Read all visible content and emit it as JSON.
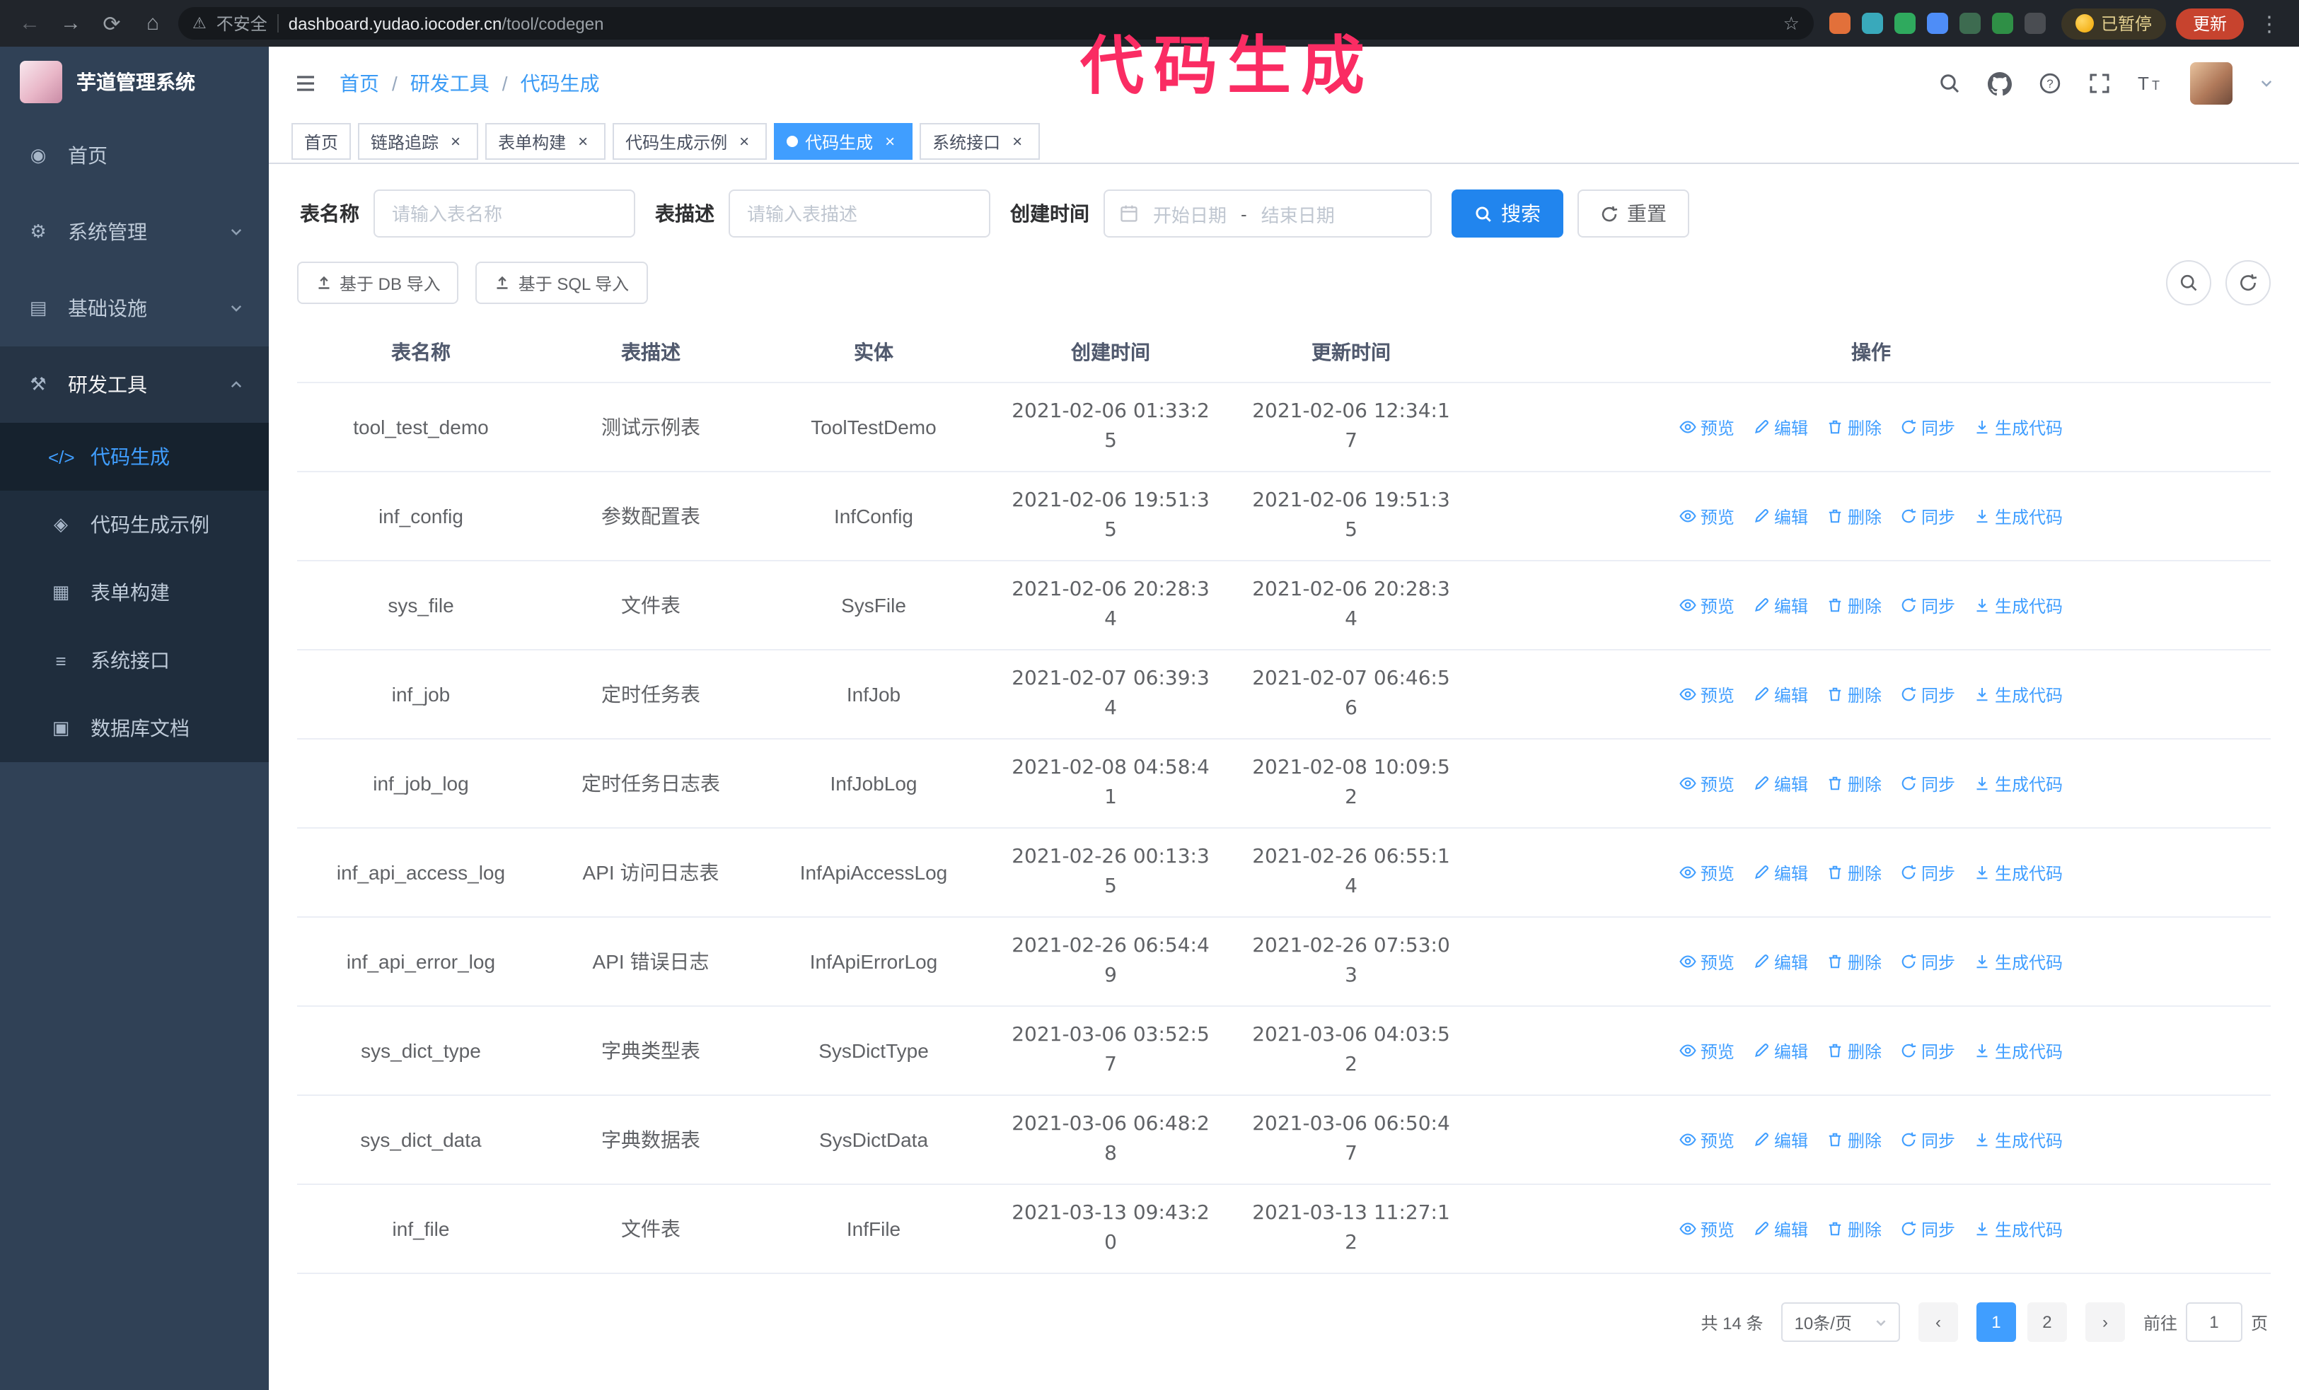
{
  "browser": {
    "security_warning": "不安全",
    "url_host": "dashboard.yudao.iocoder.cn",
    "url_path": "/tool/codegen",
    "extensions": [
      {
        "name": "extension-orange",
        "color": "#e2703a"
      },
      {
        "name": "extension-teal",
        "color": "#39a9bb"
      },
      {
        "name": "extension-green-check",
        "color": "#2faa5e"
      },
      {
        "name": "extension-blue",
        "color": "#4e8df7"
      },
      {
        "name": "extension-dark-green",
        "color": "#3d6b50"
      },
      {
        "name": "extension-leaf",
        "color": "#2f8f46"
      },
      {
        "name": "extension-puzzle",
        "color": "#4a4d52"
      }
    ],
    "paused_badge": "已暂停",
    "update_button": "更新"
  },
  "annotation": {
    "text": "代码生成",
    "color": "#fa2c63"
  },
  "sidebar": {
    "logo_title": "芋道管理系统",
    "items": [
      {
        "id": "home",
        "label": "首页",
        "icon": "dashboard"
      },
      {
        "id": "system",
        "label": "系统管理",
        "icon": "gear",
        "expandable": true
      },
      {
        "id": "infra",
        "label": "基础设施",
        "icon": "infra",
        "expandable": true
      },
      {
        "id": "devtools",
        "label": "研发工具",
        "icon": "tools",
        "expanded": true
      }
    ],
    "subitems": [
      {
        "id": "codegen",
        "label": "代码生成",
        "icon": "code",
        "active": true
      },
      {
        "id": "codegen-demo",
        "label": "代码生成示例",
        "icon": "sample"
      },
      {
        "id": "form-builder",
        "label": "表单构建",
        "icon": "form"
      },
      {
        "id": "system-api",
        "label": "系统接口",
        "icon": "api"
      },
      {
        "id": "db-doc",
        "label": "数据库文档",
        "icon": "db"
      }
    ]
  },
  "header": {
    "breadcrumb": [
      "首页",
      "研发工具",
      "代码生成"
    ],
    "separator": "/"
  },
  "tabs": [
    {
      "id": "home",
      "label": "首页"
    },
    {
      "id": "tracing",
      "label": "链路追踪",
      "closable": true
    },
    {
      "id": "form-builder",
      "label": "表单构建",
      "closable": true
    },
    {
      "id": "codegen-demo",
      "label": "代码生成示例",
      "closable": true
    },
    {
      "id": "codegen",
      "label": "代码生成",
      "closable": true,
      "active": true
    },
    {
      "id": "system-api",
      "label": "系统接口",
      "closable": true
    }
  ],
  "filters": {
    "table_name_label": "表名称",
    "table_name_placeholder": "请输入表名称",
    "table_desc_label": "表描述",
    "table_desc_placeholder": "请输入表描述",
    "create_time_label": "创建时间",
    "date_start_placeholder": "开始日期",
    "date_separator": "-",
    "date_end_placeholder": "结束日期",
    "search_button": "搜索",
    "reset_button": "重置"
  },
  "toolbar": {
    "import_db": "基于 DB 导入",
    "import_sql": "基于 SQL 导入"
  },
  "table": {
    "columns": [
      "表名称",
      "表描述",
      "实体",
      "创建时间",
      "更新时间",
      "操作"
    ],
    "actions": [
      {
        "label": "预览",
        "icon": "eye"
      },
      {
        "label": "编辑",
        "icon": "pencil"
      },
      {
        "label": "删除",
        "icon": "trash"
      },
      {
        "label": "同步",
        "icon": "sync"
      },
      {
        "label": "生成代码",
        "icon": "download"
      }
    ],
    "rows": [
      {
        "name": "tool_test_demo",
        "desc": "测试示例表",
        "entity": "ToolTestDemo",
        "created": "2021-02-06 01:33:25",
        "updated": "2021-02-06 12:34:17"
      },
      {
        "name": "inf_config",
        "desc": "参数配置表",
        "entity": "InfConfig",
        "created": "2021-02-06 19:51:35",
        "updated": "2021-02-06 19:51:35"
      },
      {
        "name": "sys_file",
        "desc": "文件表",
        "entity": "SysFile",
        "created": "2021-02-06 20:28:34",
        "updated": "2021-02-06 20:28:34"
      },
      {
        "name": "inf_job",
        "desc": "定时任务表",
        "entity": "InfJob",
        "created": "2021-02-07 06:39:34",
        "updated": "2021-02-07 06:46:56"
      },
      {
        "name": "inf_job_log",
        "desc": "定时任务日志表",
        "entity": "InfJobLog",
        "created": "2021-02-08 04:58:41",
        "updated": "2021-02-08 10:09:52"
      },
      {
        "name": "inf_api_access_log",
        "desc": "API 访问日志表",
        "entity": "InfApiAccessLog",
        "created": "2021-02-26 00:13:35",
        "updated": "2021-02-26 06:55:14"
      },
      {
        "name": "inf_api_error_log",
        "desc": "API 错误日志",
        "entity": "InfApiErrorLog",
        "created": "2021-02-26 06:54:49",
        "updated": "2021-02-26 07:53:03"
      },
      {
        "name": "sys_dict_type",
        "desc": "字典类型表",
        "entity": "SysDictType",
        "created": "2021-03-06 03:52:57",
        "updated": "2021-03-06 04:03:52"
      },
      {
        "name": "sys_dict_data",
        "desc": "字典数据表",
        "entity": "SysDictData",
        "created": "2021-03-06 06:48:28",
        "updated": "2021-03-06 06:50:47"
      },
      {
        "name": "inf_file",
        "desc": "文件表",
        "entity": "InfFile",
        "created": "2021-03-13 09:43:20",
        "updated": "2021-03-13 11:27:12"
      }
    ]
  },
  "pagination": {
    "total_text": "共 14 条",
    "page_size": "10条/页",
    "pages": [
      "1",
      "2"
    ],
    "active_page": "1",
    "goto_label": "前往",
    "goto_value": "1",
    "goto_suffix": "页"
  }
}
